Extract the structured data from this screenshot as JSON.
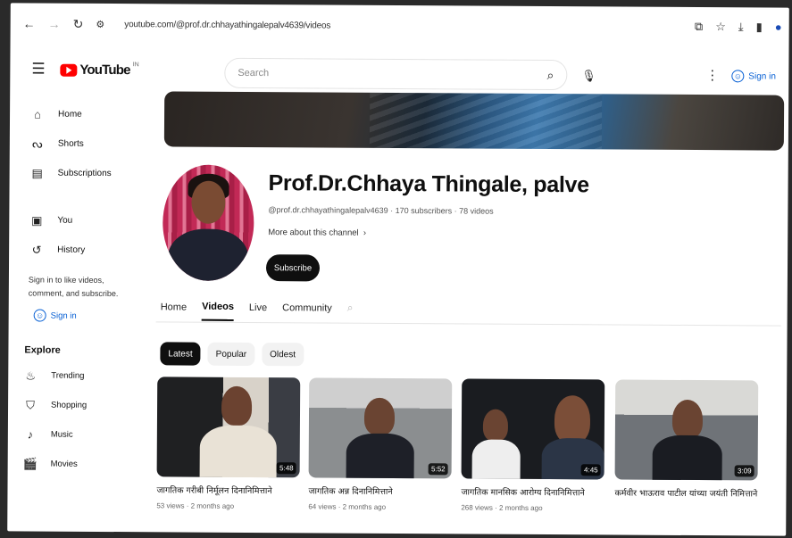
{
  "browser": {
    "url": "youtube.com/@prof.dr.chhayathingalepalv4639/videos",
    "nav_icons": [
      "back-icon",
      "forward-icon",
      "reload-icon",
      "site-settings-icon"
    ]
  },
  "masthead": {
    "logo_text": "YouTube",
    "logo_sup": "IN",
    "search_placeholder": "Search",
    "sign_in": "Sign in"
  },
  "sidebar": {
    "items": [
      {
        "label": "Home",
        "icon": "home-icon"
      },
      {
        "label": "Shorts",
        "icon": "shorts-icon"
      },
      {
        "label": "Subscriptions",
        "icon": "subscriptions-icon"
      }
    ],
    "you_items": [
      {
        "label": "You",
        "icon": "you-icon"
      },
      {
        "label": "History",
        "icon": "history-icon"
      }
    ],
    "note": "Sign in to like videos, comment, and subscribe.",
    "sign_in": "Sign in",
    "explore_title": "Explore",
    "explore_items": [
      {
        "label": "Trending",
        "icon": "trending-icon"
      },
      {
        "label": "Shopping",
        "icon": "shopping-icon"
      },
      {
        "label": "Music",
        "icon": "music-icon"
      },
      {
        "label": "Movies",
        "icon": "movies-icon"
      }
    ]
  },
  "channel": {
    "name": "Prof.Dr.Chhaya Thingale, palve",
    "meta": "@prof.dr.chhayathingalepalv4639 · 170 subscribers · 78 videos",
    "more_about": "More about this channel",
    "subscribe": "Subscribe"
  },
  "tabs": [
    "Home",
    "Videos",
    "Live",
    "Community"
  ],
  "active_tab": "Videos",
  "chips": [
    "Latest",
    "Popular",
    "Oldest"
  ],
  "active_chip": "Latest",
  "videos": [
    {
      "title": "जागतिक गरीबी निर्मूलन दिनानिमित्ताने",
      "meta": "53 views · 2 months ago",
      "duration": "5:48"
    },
    {
      "title": "जागतिक अन्न दिनानिमित्ताने",
      "meta": "64 views · 2 months ago",
      "duration": "5:52"
    },
    {
      "title": "जागतिक मानसिक आरोग्य दिनानिमित्ताने",
      "meta": "268 views · 2 months ago",
      "duration": "4:45"
    },
    {
      "title": "कर्मवीर भाऊराव पाटील यांच्या जयंती निमित्ताने",
      "meta": "",
      "duration": "3:09"
    }
  ],
  "colors": {
    "accent": "#065fd4",
    "brand": "#ff0000",
    "button": "#0f0f0f"
  }
}
